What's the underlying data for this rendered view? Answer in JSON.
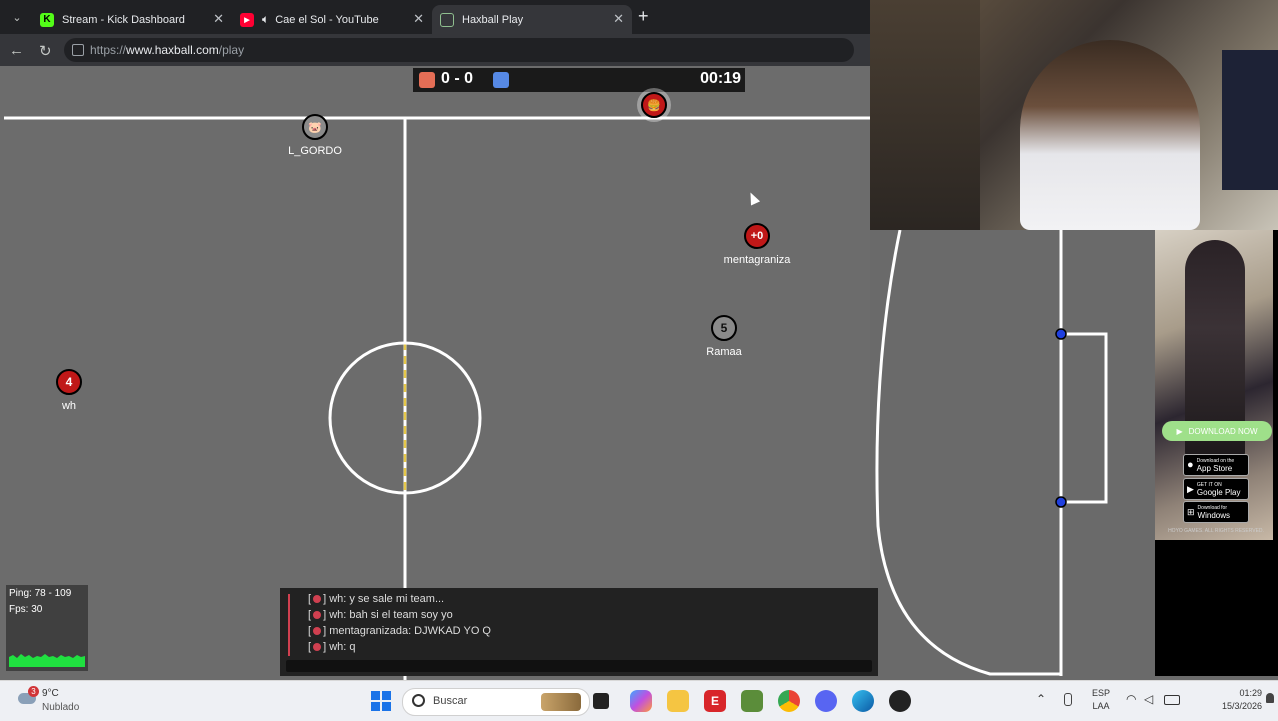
{
  "browser": {
    "tabs": [
      {
        "title": "Stream - Kick Dashboard",
        "icon": "kick-icon",
        "color": "#53fc18",
        "active": false
      },
      {
        "title": "Cae el Sol - YouTube",
        "icon": "youtube-icon",
        "color": "#ff0033",
        "active": false,
        "audio": true
      },
      {
        "title": "Haxball Play",
        "icon": "haxball-icon",
        "color": "#8fbf8f",
        "active": true
      }
    ],
    "url_prefix": "https://",
    "url_domain": "www.haxball.com",
    "url_path": "/play"
  },
  "game": {
    "score": "0 - 0",
    "time": "00:19",
    "red_color": "#e56e56",
    "blue_color": "#5689e5",
    "players": [
      {
        "name": "L_GORDO",
        "avatar": "🐷",
        "team": "spectator"
      },
      {
        "name": "mentagraniza",
        "avatar": "+0",
        "team": "red"
      },
      {
        "name": "Ramaa",
        "avatar": "5",
        "team": "spectator"
      },
      {
        "name": "wh",
        "avatar": "4",
        "team": "red"
      },
      {
        "name": "",
        "avatar": "🍔",
        "team": "red"
      }
    ],
    "stats": {
      "ping": "Ping: 78 - 109",
      "fps": "Fps: 30"
    },
    "chat": [
      {
        "author": "wh",
        "text": "wh: y se sale mi team..."
      },
      {
        "author": "wh",
        "text": "wh: bah si el team soy yo"
      },
      {
        "author": "mentagranizada",
        "text": "mentagranizada: DJWKAD YO Q"
      },
      {
        "author": "wh",
        "text": "wh: q"
      }
    ]
  },
  "ad": {
    "download_label": "DOWNLOAD NOW",
    "app_store": "App Store",
    "app_store_small": "Download on the",
    "google_play": "Google Play",
    "google_play_small": "GET IT ON",
    "windows": "Windows",
    "windows_small": "Download for",
    "footer": "HOYO GAMES. ALL RIGHTS RESERVED."
  },
  "taskbar": {
    "weather_temp": "9°C",
    "weather_desc": "Nublado",
    "weather_badge": "3",
    "search_placeholder": "Buscar",
    "lang_top": "ESP",
    "lang_bottom": "LAA",
    "time": "01:29",
    "date": "15/3/2026"
  }
}
